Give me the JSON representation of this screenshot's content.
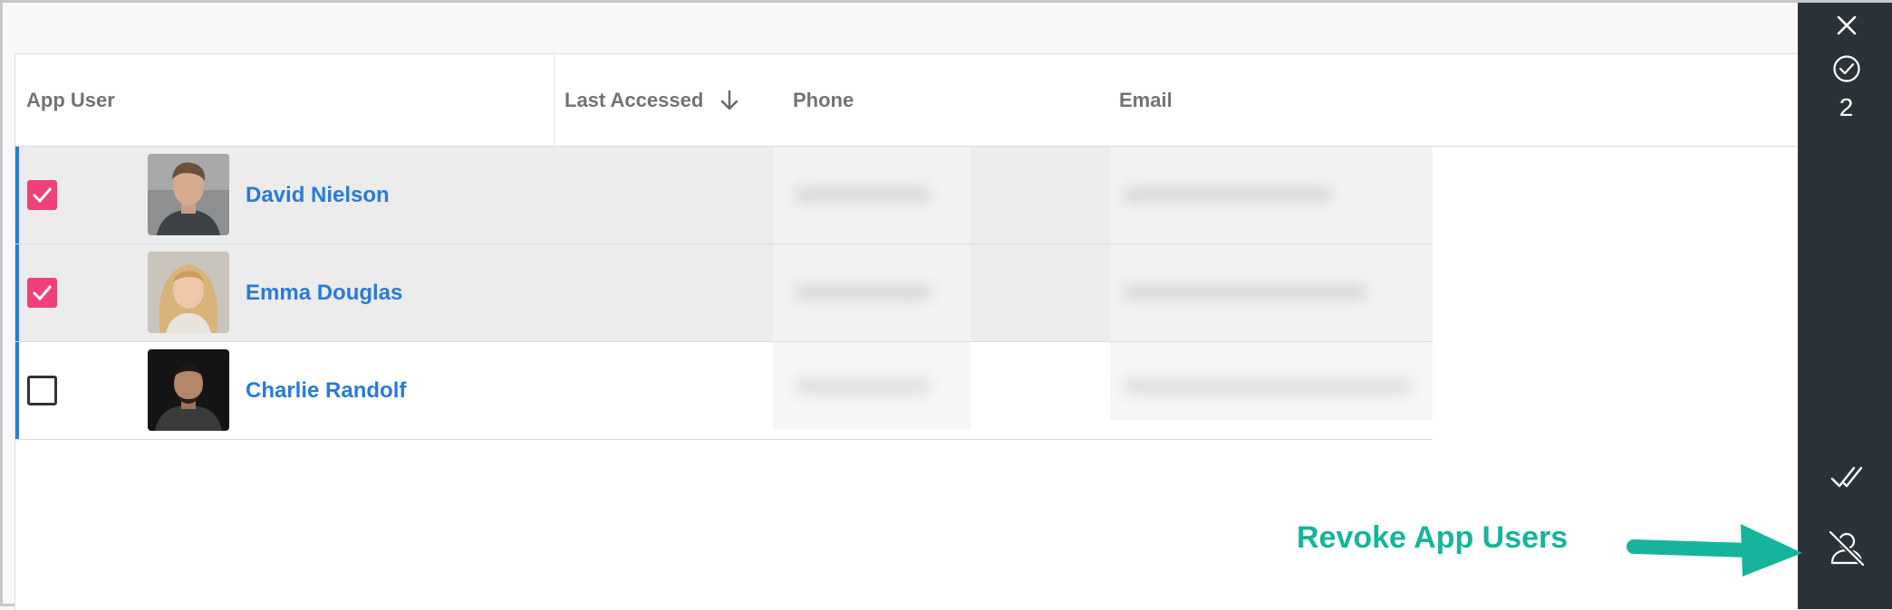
{
  "table": {
    "columns": {
      "app_user": "App User",
      "last_accessed": "Last Accessed",
      "phone": "Phone",
      "email": "Email"
    },
    "sort_icon": "arrow-down-icon",
    "rows": [
      {
        "name": "David Nielson",
        "checked": true
      },
      {
        "name": "Emma Douglas",
        "checked": true
      },
      {
        "name": "Charlie Randolf",
        "checked": false
      }
    ]
  },
  "sidebar": {
    "close_icon": "close-icon",
    "selected_icon": "check-circle-icon",
    "selected_count": "2",
    "approve_icon": "double-check-icon",
    "revoke_icon": "user-off-icon"
  },
  "callout": {
    "text": "Revoke App Users",
    "color": "#16b59b"
  },
  "colors": {
    "accent": "#2b7cd3",
    "checkbox_on": "#f0407a",
    "link": "#2a7ad8",
    "sidebar_bg": "#2b3238"
  }
}
